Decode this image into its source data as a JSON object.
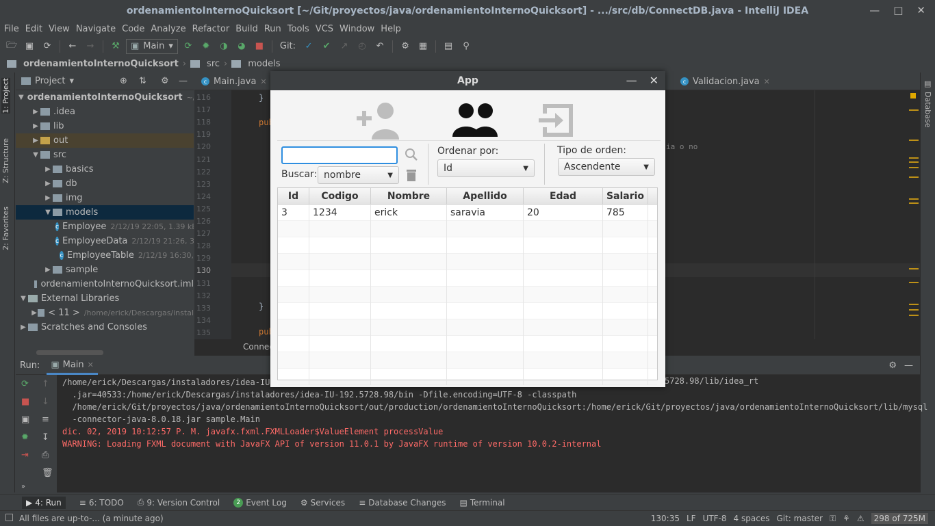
{
  "window": {
    "title": "ordenamientoInternoQuicksort [~/Git/proyectos/java/ordenamientoInternoQuicksort] - .../src/db/ConnectDB.java - IntelliJ IDEA"
  },
  "menu": [
    "File",
    "Edit",
    "View",
    "Navigate",
    "Code",
    "Analyze",
    "Refactor",
    "Build",
    "Run",
    "Tools",
    "VCS",
    "Window",
    "Help"
  ],
  "toolbar": {
    "run_config": "Main",
    "git_label": "Git:"
  },
  "breadcrumb": [
    "ordenamientoInternoQuicksort",
    "src",
    "models"
  ],
  "left_tabs": [
    "1: Project",
    "Z: Structure",
    "2: Favorites"
  ],
  "right_tabs": [
    "Database"
  ],
  "project": {
    "header": "Project",
    "items": [
      {
        "label": "ordenamientoInternoQuicksort",
        "extra": "~/Git/",
        "level": 0,
        "open": true,
        "kind": "folder"
      },
      {
        "label": ".idea",
        "extra": "",
        "level": 1,
        "open": false,
        "kind": "folder"
      },
      {
        "label": "lib",
        "extra": "",
        "level": 1,
        "open": false,
        "kind": "folder"
      },
      {
        "label": "out",
        "extra": "",
        "level": 1,
        "open": false,
        "kind": "folder"
      },
      {
        "label": "src",
        "extra": "",
        "level": 1,
        "open": true,
        "kind": "folder"
      },
      {
        "label": "basics",
        "extra": "",
        "level": 2,
        "open": false,
        "kind": "folder"
      },
      {
        "label": "db",
        "extra": "",
        "level": 2,
        "open": false,
        "kind": "folder"
      },
      {
        "label": "img",
        "extra": "",
        "level": 2,
        "open": false,
        "kind": "folder"
      },
      {
        "label": "models",
        "extra": "",
        "level": 2,
        "open": true,
        "kind": "folder"
      },
      {
        "label": "Employee",
        "extra": "2/12/19 22:05, 1.39 kB",
        "level": 3,
        "open": null,
        "kind": "class"
      },
      {
        "label": "EmployeeData",
        "extra": "2/12/19 21:26, 3",
        "level": 3,
        "open": null,
        "kind": "class"
      },
      {
        "label": "EmployeeTable",
        "extra": "2/12/19 16:30,",
        "level": 3,
        "open": null,
        "kind": "class"
      },
      {
        "label": "sample",
        "extra": "",
        "level": 2,
        "open": false,
        "kind": "folder"
      },
      {
        "label": "ordenamientoInternoQuicksort.iml",
        "extra": "",
        "level": 1,
        "open": null,
        "kind": "file"
      },
      {
        "label": "External Libraries",
        "extra": "",
        "level": 0,
        "open": true,
        "kind": "lib"
      },
      {
        "label": "< 11 >",
        "extra": "/home/erick/Descargas/instal",
        "level": 1,
        "open": false,
        "kind": "folder"
      },
      {
        "label": "Scratches and Consoles",
        "extra": "",
        "level": 0,
        "open": false,
        "kind": "scratch"
      }
    ]
  },
  "editor": {
    "tabs": [
      "Main.java",
      "Validacion.java"
    ],
    "line_numbers": [
      "116",
      "117",
      "118",
      "119",
      "120",
      "121",
      "122",
      "123",
      "124",
      "125",
      "126",
      "127",
      "128",
      "129",
      "130",
      "131",
      "132",
      "133",
      "134",
      "135"
    ],
    "code_fragments": {
      "l116": "}",
      "l118": "publ",
      "l120": "ia o no",
      "l133": "}",
      "l135": "publ"
    },
    "crumb": "Connec"
  },
  "run": {
    "label": "Run:",
    "tab": "Main",
    "lines": [
      {
        "text": "/home/erick/Descargas/instaladores/idea-IU-",
        "err": false
      },
      {
        "text": "  .jar=40533:/home/erick/Descargas/instaladores/idea-IU-192.5728.98/bin -Dfile.encoding=UTF-8 -classpath",
        "err": false
      },
      {
        "text": "  /home/erick/Git/proyectos/java/ordenamientoInternoQuicksort/out/production/ordenamientoInternoQuicksort:/home/erick/Git/proyectos/java/ordenamientoInternoQuicksort/lib/mysql",
        "err": false
      },
      {
        "text": "  -connector-java-8.0.18.jar sample.Main",
        "err": false
      },
      {
        "text": "dic. 02, 2019 10:12:57 P. M. javafx.fxml.FXMLLoader$ValueElement processValue",
        "err": true
      },
      {
        "text": "WARNING: Loading FXML document with JavaFX API of version 11.0.1 by JavaFX runtime of version 10.0.2-internal",
        "err": true
      }
    ],
    "line0_tail": "5728.98/lib/idea_rt"
  },
  "bottom_tabs": [
    "4: Run",
    "6: TODO",
    "9: Version Control",
    "Event Log",
    "Services",
    "Database Changes",
    "Terminal"
  ],
  "event_log_badge": "2",
  "status": {
    "message": "All files are up-to-... (a minute ago)",
    "position": "130:35",
    "line_sep": "LF",
    "encoding": "UTF-8",
    "indent": "4 spaces",
    "branch": "Git: master",
    "memory": "298 of 725M"
  },
  "app": {
    "title": "App",
    "search_value": "",
    "buscar_label": "Buscar:",
    "buscar_value": "nombre",
    "ordenar_label": "Ordenar por:",
    "ordenar_value": "Id",
    "tipo_label": "Tipo de orden:",
    "tipo_value": "Ascendente",
    "columns": [
      "Id",
      "Codigo",
      "Nombre",
      "Apellido",
      "Edad",
      "Salario"
    ],
    "rows": [
      [
        "3",
        "1234",
        "erick",
        "saravia",
        "20",
        "785"
      ]
    ]
  },
  "colors": {
    "accent": "#2e8ee0",
    "ide_bg": "#3c3f41",
    "editor_bg": "#2b2b2b",
    "error": "#ff6b68"
  }
}
